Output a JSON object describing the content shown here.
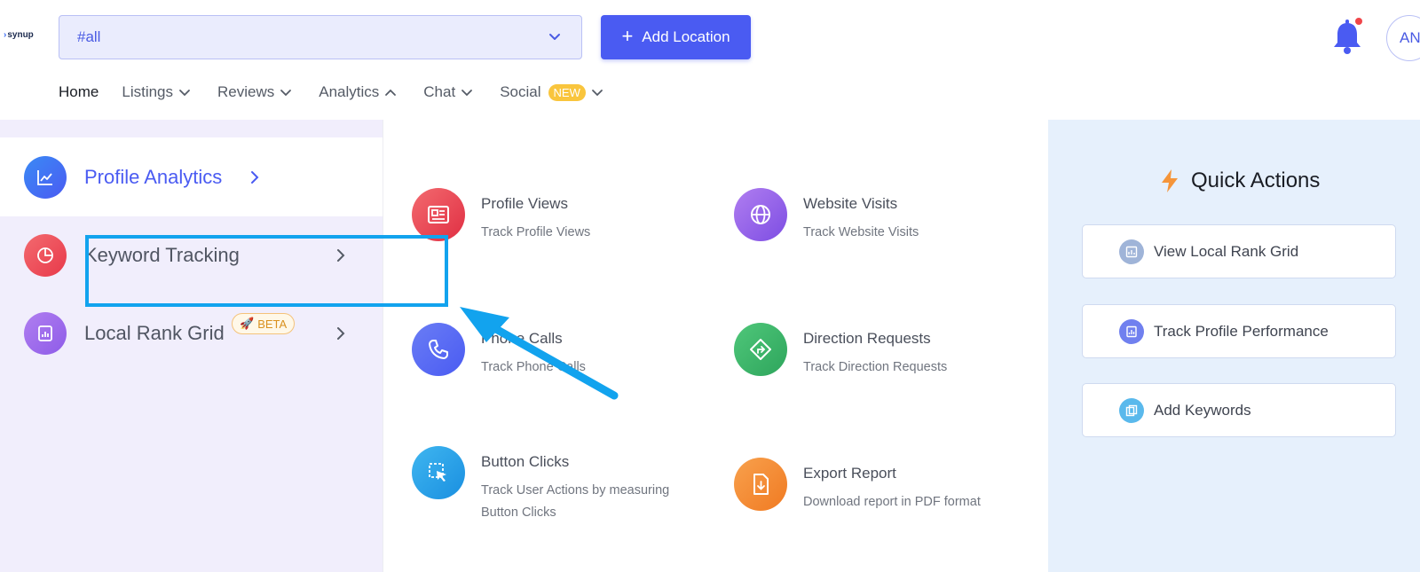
{
  "header": {
    "logo_text": "synup",
    "location_value": "#all",
    "add_location_label": "Add Location",
    "avatar_initials": "AN",
    "notification_color": "#4a5bf2"
  },
  "nav": {
    "items": [
      {
        "label": "Home"
      },
      {
        "label": "Listings"
      },
      {
        "label": "Reviews"
      },
      {
        "label": "Analytics"
      },
      {
        "label": "Chat"
      },
      {
        "label": "Social",
        "badge": "NEW"
      }
    ]
  },
  "sidebar": {
    "items": [
      {
        "label": "Profile Analytics",
        "icon": "chart-line-icon",
        "active": true
      },
      {
        "label": "Keyword Tracking",
        "icon": "pie-chart-icon"
      },
      {
        "label": "Local Rank Grid",
        "icon": "bar-report-icon",
        "badge": "BETA"
      }
    ]
  },
  "features": [
    {
      "title": "Profile Views",
      "subtitle": "Track Profile Views",
      "icon": "profile-card-icon"
    },
    {
      "title": "Website Visits",
      "subtitle": "Track Website Visits",
      "icon": "globe-icon"
    },
    {
      "title": "Phone Calls",
      "subtitle": "Track Phone Calls",
      "icon": "phone-icon"
    },
    {
      "title": "Direction Requests",
      "subtitle": "Track Direction Requests",
      "icon": "direction-icon"
    },
    {
      "title": "Button Clicks",
      "subtitle_line1": "Track User Actions by measuring",
      "subtitle_line2": "Button Clicks",
      "icon": "cursor-click-icon"
    },
    {
      "title": "Export Report",
      "subtitle": "Download report in PDF format",
      "icon": "download-doc-icon"
    }
  ],
  "quick_actions": {
    "title": "Quick Actions",
    "items": [
      {
        "label": "View Local Rank Grid"
      },
      {
        "label": "Track Profile Performance"
      },
      {
        "label": "Add Keywords"
      }
    ]
  },
  "colors": {
    "accent": "#4a5bf2",
    "annotation": "#12a3ee",
    "bolt": "#f5953a"
  }
}
